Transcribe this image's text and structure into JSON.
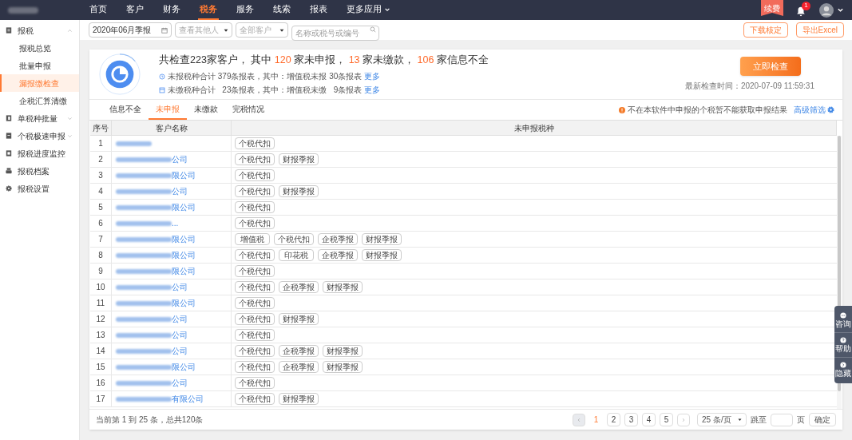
{
  "nav": {
    "items": [
      {
        "label": "首页",
        "selected": false
      },
      {
        "label": "客户",
        "selected": false
      },
      {
        "label": "财务",
        "selected": false
      },
      {
        "label": "税务",
        "selected": true
      },
      {
        "label": "服务",
        "selected": false
      },
      {
        "label": "线索",
        "selected": false
      },
      {
        "label": "报表",
        "selected": false
      },
      {
        "label": "更多应用",
        "selected": false,
        "dropdown": true
      }
    ],
    "renew": "续费",
    "notifications": "1"
  },
  "sidebar": {
    "items": [
      {
        "label": "报税",
        "expanded": true,
        "children": [
          {
            "label": "报税总览",
            "selected": false
          },
          {
            "label": "批量申报",
            "selected": false
          },
          {
            "label": "漏报缴检查",
            "selected": true
          },
          {
            "label": "企税汇算清缴",
            "selected": false
          }
        ]
      },
      {
        "label": "单税种批量",
        "expanded": false
      },
      {
        "label": "个税极速申报",
        "expanded": false
      },
      {
        "label": "报税进度监控"
      },
      {
        "label": "报税档案"
      },
      {
        "label": "报税设置"
      }
    ]
  },
  "filters": {
    "period": "2020年06月季报",
    "person_placeholder": "查看其他人",
    "customer_filter": "全部客户",
    "search_placeholder": "名称或税号或编号",
    "buttons": [
      "下载核定",
      "导出Excel"
    ]
  },
  "summary": {
    "headline": "共检查223家客户， 其中 **120** 家未申报， **13** 家未缴款， **106** 家信息不全",
    "unfiled": "未报税种合计 379条报表，其中：增值税未报 30条报表",
    "unpaid": "未缴税种合计   23条报表，其中：增值税未缴   9条报表",
    "unfiled_more": "更多",
    "unpaid_more": "更多",
    "check_button": "立即检查",
    "last_check": "最新检查时间：2020-07-09 11:59:31"
  },
  "tabs": [
    {
      "label": "信息不全",
      "selected": false
    },
    {
      "label": "未申报",
      "selected": true
    },
    {
      "label": "未缴款",
      "selected": false
    },
    {
      "label": "完税情况",
      "selected": false
    }
  ],
  "notice": "不在本软件中申报的个税暂不能获取申报结果",
  "advanced_filter": "高级筛选",
  "table": {
    "columns": [
      "序号",
      "客户名称",
      "未申报税种"
    ],
    "rows": [
      {
        "index": "1",
        "name_tail": "",
        "taxes": [
          "个税代扣"
        ]
      },
      {
        "index": "2",
        "name_tail": "公司",
        "taxes": [
          "个税代扣",
          "财报季报"
        ]
      },
      {
        "index": "3",
        "name_tail": "限公司",
        "taxes": [
          "个税代扣"
        ]
      },
      {
        "index": "4",
        "name_tail": "公司",
        "taxes": [
          "个税代扣",
          "财报季报"
        ]
      },
      {
        "index": "5",
        "name_tail": "限公司",
        "taxes": [
          "个税代扣"
        ]
      },
      {
        "index": "6",
        "name_tail": "...",
        "taxes": [
          "个税代扣"
        ]
      },
      {
        "index": "7",
        "name_tail": "限公司",
        "taxes": [
          "增值税",
          "个税代扣",
          "企税季报",
          "财报季报"
        ]
      },
      {
        "index": "8",
        "name_tail": "限公司",
        "taxes": [
          "个税代扣",
          "印花税",
          "企税季报",
          "财报季报"
        ]
      },
      {
        "index": "9",
        "name_tail": "限公司",
        "taxes": [
          "个税代扣"
        ]
      },
      {
        "index": "10",
        "name_tail": "公司",
        "taxes": [
          "个税代扣",
          "企税季报",
          "财报季报"
        ]
      },
      {
        "index": "11",
        "name_tail": "限公司",
        "taxes": [
          "个税代扣"
        ]
      },
      {
        "index": "12",
        "name_tail": "公司",
        "taxes": [
          "个税代扣",
          "财报季报"
        ]
      },
      {
        "index": "13",
        "name_tail": "公司",
        "taxes": [
          "个税代扣"
        ]
      },
      {
        "index": "14",
        "name_tail": "公司",
        "taxes": [
          "个税代扣",
          "企税季报",
          "财报季报"
        ]
      },
      {
        "index": "15",
        "name_tail": "限公司",
        "taxes": [
          "个税代扣",
          "企税季报",
          "财报季报"
        ]
      },
      {
        "index": "16",
        "name_tail": "公司",
        "taxes": [
          "个税代扣"
        ]
      },
      {
        "index": "17",
        "name_tail": "有限公司",
        "taxes": [
          "个税代扣",
          "财报季报"
        ]
      }
    ]
  },
  "pagination": {
    "summary": "当前第 1 到 25 条，总共120条",
    "pages": [
      {
        "label": "1",
        "selected": true
      },
      {
        "label": "2",
        "selected": false
      },
      {
        "label": "3",
        "selected": false
      },
      {
        "label": "4",
        "selected": false
      },
      {
        "label": "5",
        "selected": false
      }
    ],
    "page_size": "25 条/页",
    "goto_label": "跳至",
    "page_unit": "页",
    "confirm": "确定"
  },
  "float_tools": [
    "咨询",
    "帮助",
    "隐藏"
  ]
}
